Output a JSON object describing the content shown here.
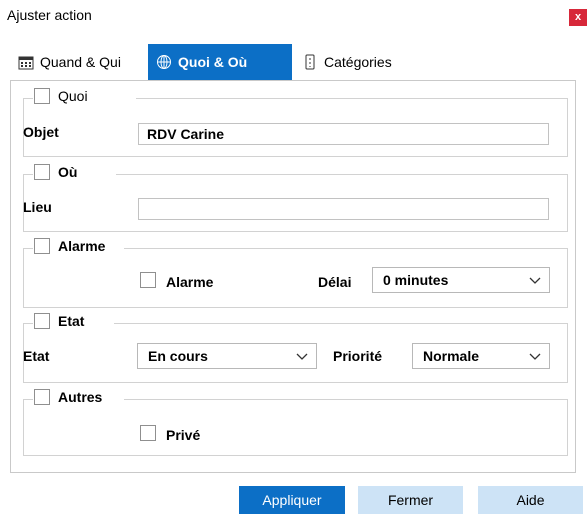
{
  "window": {
    "title": "Ajuster action",
    "close_label": "x"
  },
  "tabs": [
    {
      "label": "Quand & Qui",
      "icon": "calendar-icon"
    },
    {
      "label": "Quoi & Où",
      "icon": "globe-icon"
    },
    {
      "label": "Catégories",
      "icon": "tag-icon"
    }
  ],
  "groups": {
    "quoi": {
      "label": "Quoi",
      "field_label": "Objet",
      "value": "RDV Carine"
    },
    "ou": {
      "label": "Où",
      "field_label": "Lieu",
      "value": ""
    },
    "alarme": {
      "label": "Alarme",
      "checkbox_label": "Alarme",
      "delay_label": "Délai",
      "delay_value": "0 minutes"
    },
    "etat": {
      "label": "Etat",
      "field_label": "Etat",
      "state_value": "En cours",
      "priority_label": "Priorité",
      "priority_value": "Normale"
    },
    "autres": {
      "label": "Autres",
      "private_label": "Privé"
    }
  },
  "buttons": {
    "apply": "Appliquer",
    "close": "Fermer",
    "help": "Aide"
  },
  "colors": {
    "accent": "#0c6fc6",
    "secondary_button": "#cde3f6",
    "close_button": "#d7283a"
  }
}
